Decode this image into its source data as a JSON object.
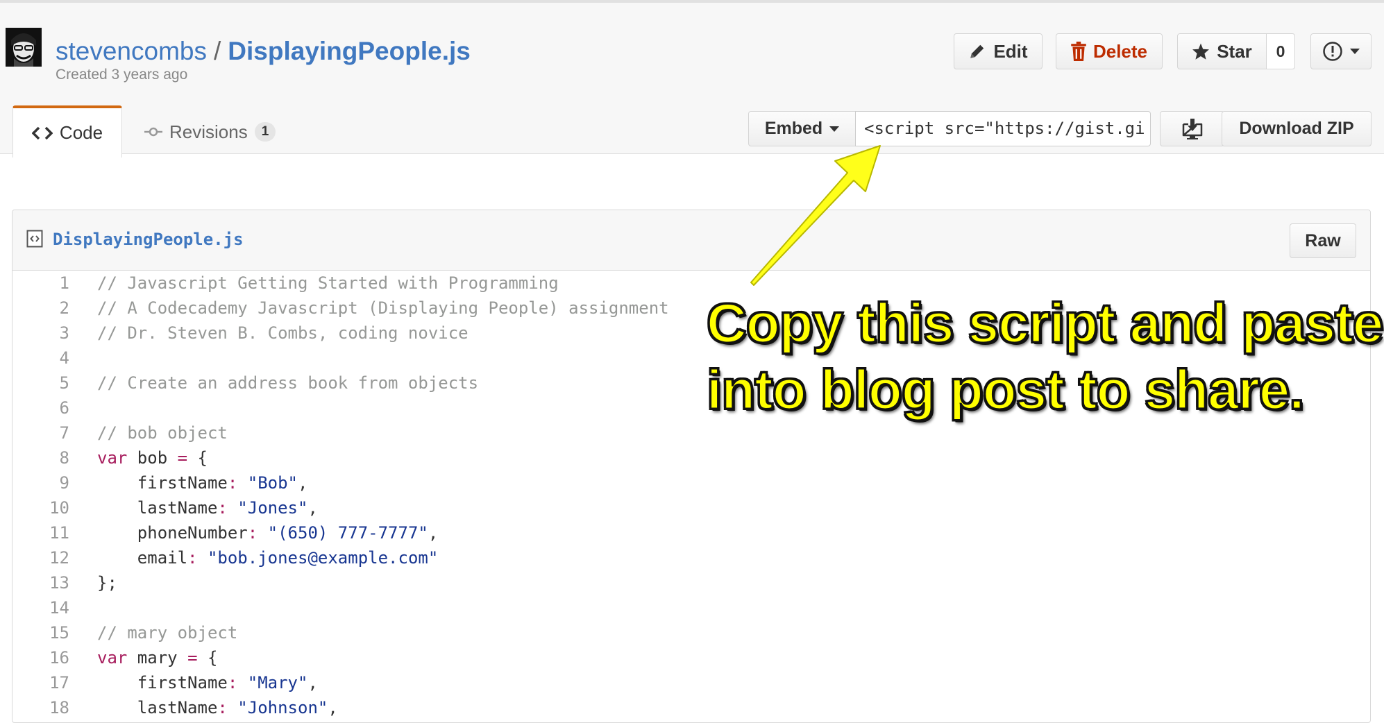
{
  "gist": {
    "owner": "stevencombs",
    "separator": "/",
    "name": "DisplayingPeople.js",
    "created": "Created 3 years ago"
  },
  "actions": {
    "edit_label": "Edit",
    "delete_label": "Delete",
    "star_label": "Star",
    "star_count": "0"
  },
  "tabs": [
    {
      "label": "Code",
      "active": true
    },
    {
      "label": "Revisions",
      "count": "1",
      "active": false
    }
  ],
  "embed": {
    "label": "Embed",
    "value": "<script src=\"https://gist.gi"
  },
  "download_label": "Download ZIP",
  "file": {
    "name": "DisplayingPeople.js",
    "raw_label": "Raw",
    "lines": [
      {
        "n": "1",
        "tokens": [
          {
            "t": "comment",
            "s": "// Javascript Getting Started with Programming"
          }
        ]
      },
      {
        "n": "2",
        "tokens": [
          {
            "t": "comment",
            "s": "// A Codecademy Javascript (Displaying People) assignment"
          }
        ]
      },
      {
        "n": "3",
        "tokens": [
          {
            "t": "comment",
            "s": "// Dr. Steven B. Combs, coding novice"
          }
        ]
      },
      {
        "n": "4",
        "tokens": []
      },
      {
        "n": "5",
        "tokens": [
          {
            "t": "comment",
            "s": "// Create an address book from objects"
          }
        ]
      },
      {
        "n": "6",
        "tokens": []
      },
      {
        "n": "7",
        "tokens": [
          {
            "t": "comment",
            "s": "// bob object"
          }
        ]
      },
      {
        "n": "8",
        "tokens": [
          {
            "t": "keyword",
            "s": "var"
          },
          {
            "t": "plain",
            "s": " bob "
          },
          {
            "t": "keyword",
            "s": "="
          },
          {
            "t": "plain",
            "s": " {"
          }
        ]
      },
      {
        "n": "9",
        "tokens": [
          {
            "t": "plain",
            "s": "    firstName"
          },
          {
            "t": "keyword",
            "s": ":"
          },
          {
            "t": "plain",
            "s": " "
          },
          {
            "t": "string",
            "s": "\"Bob\""
          },
          {
            "t": "plain",
            "s": ","
          }
        ]
      },
      {
        "n": "10",
        "tokens": [
          {
            "t": "plain",
            "s": "    lastName"
          },
          {
            "t": "keyword",
            "s": ":"
          },
          {
            "t": "plain",
            "s": " "
          },
          {
            "t": "string",
            "s": "\"Jones\""
          },
          {
            "t": "plain",
            "s": ","
          }
        ]
      },
      {
        "n": "11",
        "tokens": [
          {
            "t": "plain",
            "s": "    phoneNumber"
          },
          {
            "t": "keyword",
            "s": ":"
          },
          {
            "t": "plain",
            "s": " "
          },
          {
            "t": "string",
            "s": "\"(650) 777-7777\""
          },
          {
            "t": "plain",
            "s": ","
          }
        ]
      },
      {
        "n": "12",
        "tokens": [
          {
            "t": "plain",
            "s": "    email"
          },
          {
            "t": "keyword",
            "s": ":"
          },
          {
            "t": "plain",
            "s": " "
          },
          {
            "t": "string",
            "s": "\"bob.jones@example.com\""
          }
        ]
      },
      {
        "n": "13",
        "tokens": [
          {
            "t": "plain",
            "s": "};"
          }
        ]
      },
      {
        "n": "14",
        "tokens": []
      },
      {
        "n": "15",
        "tokens": [
          {
            "t": "comment",
            "s": "// mary object"
          }
        ]
      },
      {
        "n": "16",
        "tokens": [
          {
            "t": "keyword",
            "s": "var"
          },
          {
            "t": "plain",
            "s": " mary "
          },
          {
            "t": "keyword",
            "s": "="
          },
          {
            "t": "plain",
            "s": " {"
          }
        ]
      },
      {
        "n": "17",
        "tokens": [
          {
            "t": "plain",
            "s": "    firstName"
          },
          {
            "t": "keyword",
            "s": ":"
          },
          {
            "t": "plain",
            "s": " "
          },
          {
            "t": "string",
            "s": "\"Mary\""
          },
          {
            "t": "plain",
            "s": ","
          }
        ]
      },
      {
        "n": "18",
        "tokens": [
          {
            "t": "plain",
            "s": "    lastName"
          },
          {
            "t": "keyword",
            "s": ":"
          },
          {
            "t": "plain",
            "s": " "
          },
          {
            "t": "string",
            "s": "\"Johnson\""
          },
          {
            "t": "plain",
            "s": ","
          }
        ]
      }
    ]
  },
  "annotation": {
    "line1": "Copy this script and paste",
    "line2": "into blog post to share."
  },
  "icons": {
    "edit": "pencil-icon",
    "delete": "trash-icon",
    "star": "star-icon",
    "report": "alert-icon",
    "code_tab": "code-brackets-icon",
    "revisions_tab": "git-commit-icon",
    "embed_caret": "caret-down-icon",
    "clone": "desktop-download-icon",
    "file": "file-code-icon"
  },
  "colors": {
    "link": "#4078c0",
    "delete": "#bd2c00",
    "tab_accent": "#d26911",
    "annotation_fill": "#ffff00",
    "arrow_fill": "#ffff1a"
  }
}
